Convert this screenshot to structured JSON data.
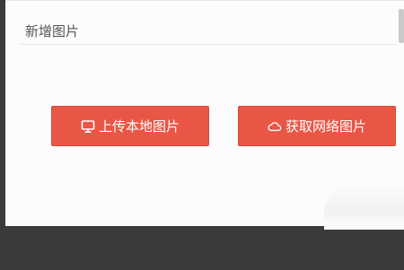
{
  "dialog": {
    "title": "新增图片"
  },
  "buttons": {
    "upload_local": {
      "label": "上传本地图片",
      "icon": "monitor-icon"
    },
    "fetch_network": {
      "label": "获取网络图片",
      "icon": "cloud-icon"
    }
  },
  "colors": {
    "button_bg": "#e95646",
    "background_dark": "#3b3b3b",
    "dialog_bg": "#fcfcfc"
  }
}
